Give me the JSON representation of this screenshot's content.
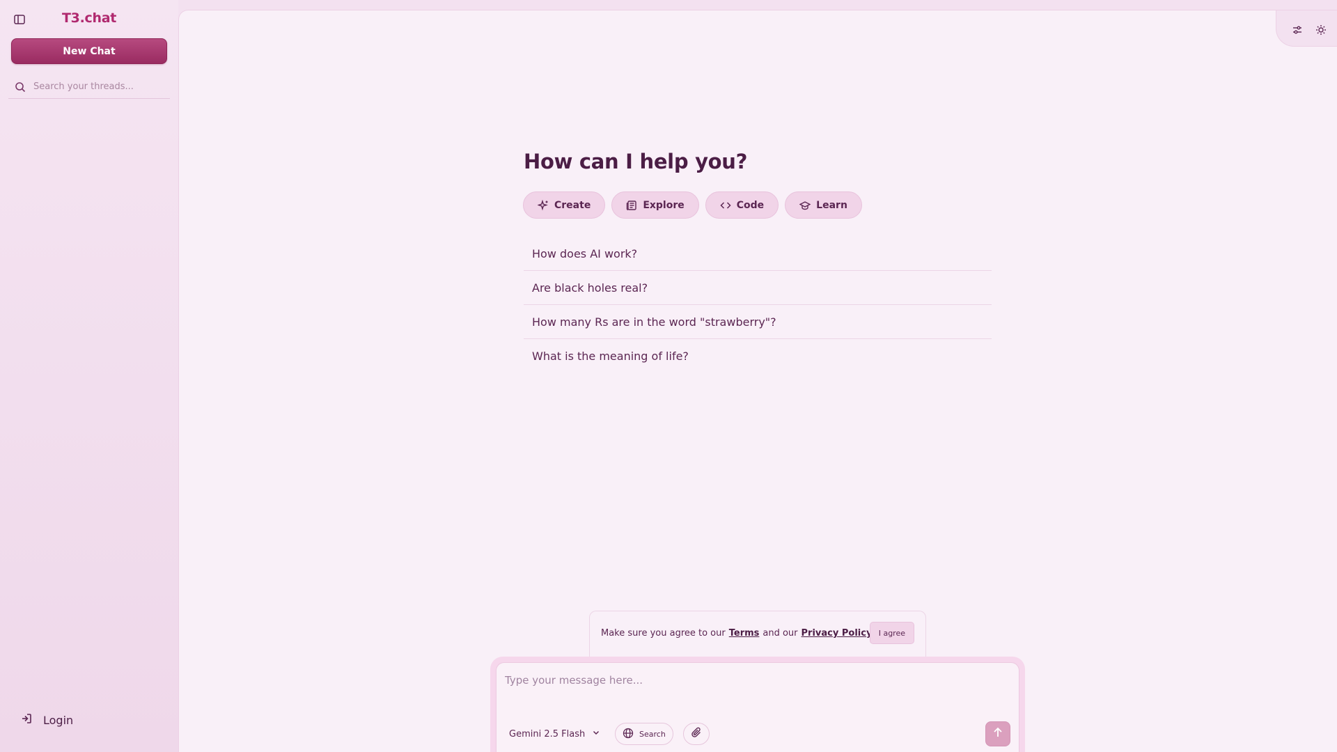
{
  "sidebar": {
    "logo": "T3.chat",
    "new_chat_label": "New Chat",
    "search_placeholder": "Search your threads...",
    "login_label": "Login"
  },
  "main": {
    "heading": "How can I help you?",
    "chips": [
      {
        "label": "Create",
        "icon": "sparkles-icon"
      },
      {
        "label": "Explore",
        "icon": "newspaper-icon"
      },
      {
        "label": "Code",
        "icon": "code-icon"
      },
      {
        "label": "Learn",
        "icon": "graduation-cap-icon"
      }
    ],
    "suggestions": [
      "How does AI work?",
      "Are black holes real?",
      "How many Rs are in the word \"strawberry\"?",
      "What is the meaning of life?"
    ]
  },
  "terms": {
    "prefix": "Make sure you agree to our",
    "terms_link": "Terms",
    "middle": "and our",
    "privacy_link": "Privacy Policy",
    "agree_label": "I agree"
  },
  "composer": {
    "placeholder": "Type your message here...",
    "model": "Gemini 2.5 Flash",
    "search_label": "Search"
  },
  "colors": {
    "accent": "#b0296f",
    "button": "#a23468",
    "background": "#f9f0f8",
    "sidebar": "#f3e1f0",
    "text": "#4b1d45"
  }
}
